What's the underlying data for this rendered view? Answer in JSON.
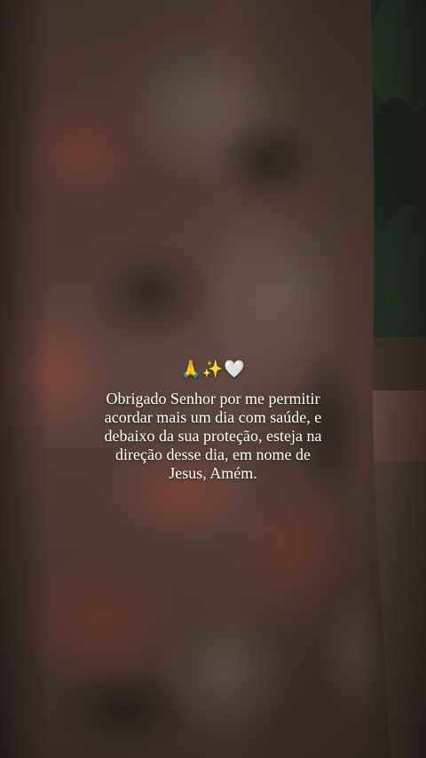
{
  "story": {
    "emoji_line": "🙏✨🤍",
    "prayer_text": "Obrigado Senhor por me permitir\nacordar mais um dia com saúde, e\ndebaixo da sua proteção, esteja na\ndireção desse dia, em nome de\nJesus, Amém."
  },
  "colors": {
    "bark_base": "#5f4a40",
    "bark_red": "#8a4a3c",
    "bark_dark": "#2f2420",
    "foliage": "#1f3a2a",
    "road": "#7a5e52",
    "text": "#ffffff"
  }
}
